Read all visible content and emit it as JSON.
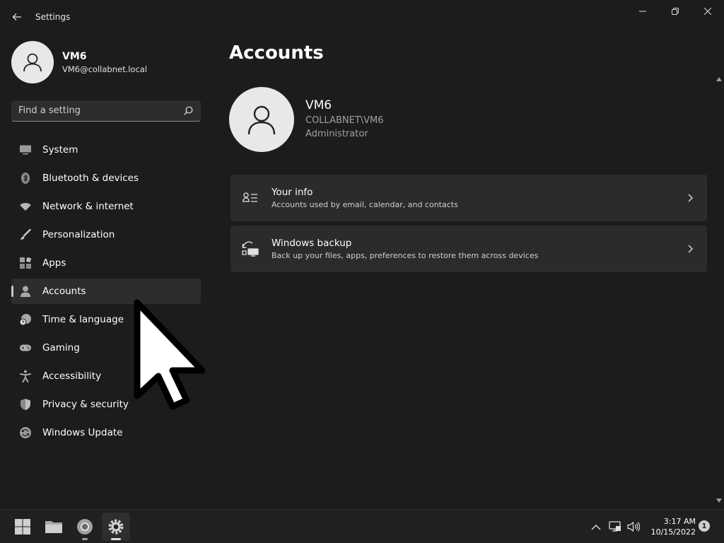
{
  "window": {
    "title": "Settings",
    "controls": [
      "minimize",
      "restore",
      "close"
    ]
  },
  "profile": {
    "name": "VM6",
    "email": "VM6@collabnet.local"
  },
  "search": {
    "placeholder": "Find a setting",
    "value": ""
  },
  "sidebar": {
    "items": [
      {
        "label": "System",
        "icon": "monitor-icon"
      },
      {
        "label": "Bluetooth & devices",
        "icon": "bluetooth-icon"
      },
      {
        "label": "Network & internet",
        "icon": "wifi-icon"
      },
      {
        "label": "Personalization",
        "icon": "brush-icon"
      },
      {
        "label": "Apps",
        "icon": "apps-icon"
      },
      {
        "label": "Accounts",
        "icon": "person-icon",
        "active": true
      },
      {
        "label": "Time & language",
        "icon": "clock-globe-icon"
      },
      {
        "label": "Gaming",
        "icon": "gamepad-icon"
      },
      {
        "label": "Accessibility",
        "icon": "accessibility-icon"
      },
      {
        "label": "Privacy & security",
        "icon": "shield-icon"
      },
      {
        "label": "Windows Update",
        "icon": "update-icon"
      }
    ]
  },
  "main": {
    "title": "Accounts",
    "user": {
      "name": "VM6",
      "domain": "COLLABNET\\VM6",
      "role": "Administrator"
    },
    "cards": [
      {
        "title": "Your info",
        "subtitle": "Accounts used by email, calendar, and contacts",
        "icon": "contact-card-icon"
      },
      {
        "title": "Windows backup",
        "subtitle": "Back up your files, apps, preferences to restore them across devices",
        "icon": "backup-icon"
      }
    ]
  },
  "taskbar": {
    "apps": [
      "start-icon",
      "file-explorer-icon",
      "chrome-icon",
      "settings-icon"
    ],
    "time": "3:17 AM",
    "date": "10/15/2022",
    "notification_count": "1"
  }
}
